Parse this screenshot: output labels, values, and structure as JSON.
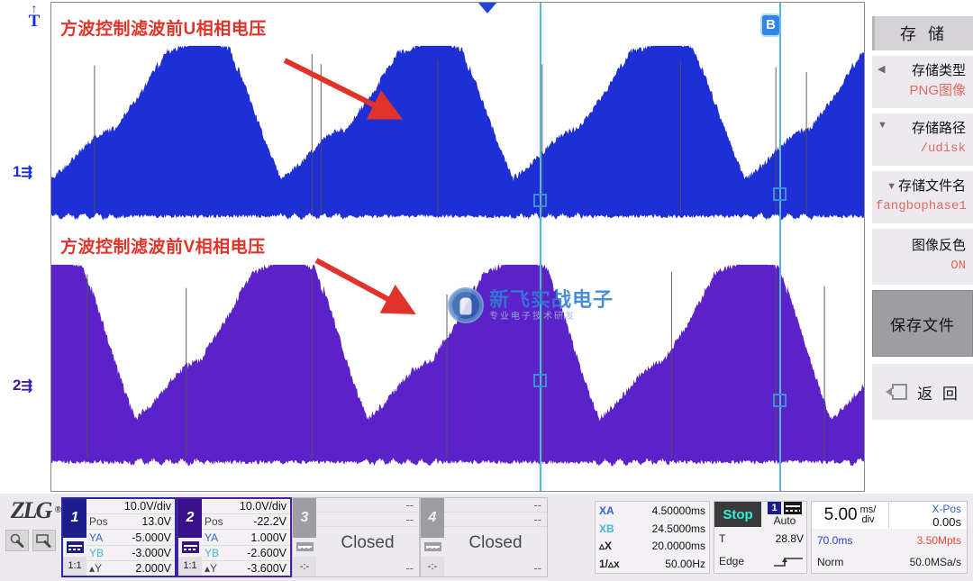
{
  "annotations": {
    "ch1_note": "方波控制滤波前U相相电压",
    "ch2_note": "方波控制滤波前V相相电压"
  },
  "markers": {
    "trigger_level_label": "T",
    "ch1_label": "1",
    "ch2_label": "2",
    "cursor_b_label": "B"
  },
  "watermark": {
    "main": "新飞实战电子",
    "sub": "专业电子技术研发"
  },
  "menu": {
    "title": "存 储",
    "items": [
      {
        "label": "存储类型",
        "value": "PNG图像",
        "caret": "left"
      },
      {
        "label": "存储路径",
        "value": "/udisk",
        "caret": "down"
      },
      {
        "label": "存储文件名",
        "value": "fangbophase1",
        "caret": "down"
      },
      {
        "label": "图像反色",
        "value": "ON",
        "caret": "none"
      }
    ],
    "save_button": "保存文件",
    "back_button": "返 回",
    "back_icon": "back-arrow-icon"
  },
  "status": {
    "brand": "ZLG",
    "brand_mark": "®",
    "icons": [
      "measure-icon",
      "screen-icon"
    ],
    "channels": [
      {
        "num": "1",
        "closed": false,
        "scale": "10.0V/div",
        "pos_label": "Pos",
        "pos": "13.0V",
        "ya_label": "YA",
        "ya": "-5.000V",
        "yb_label": "YB",
        "yb": "-3.000V",
        "dy_label": "▴Y",
        "dy": "2.000V",
        "ratio": "1:1",
        "coupling": "dc-ac-icon"
      },
      {
        "num": "2",
        "closed": false,
        "scale": "10.0V/div",
        "pos_label": "Pos",
        "pos": "-22.2V",
        "ya_label": "YA",
        "ya": "1.000V",
        "yb_label": "YB",
        "yb": "-2.600V",
        "dy_label": "▴Y",
        "dy": "-3.600V",
        "ratio": "1:1",
        "coupling": "dc-ac-icon"
      },
      {
        "num": "3",
        "closed": true,
        "closed_text": "Closed",
        "dash": "--",
        "ratio": "-:-"
      },
      {
        "num": "4",
        "closed": true,
        "closed_text": "Closed",
        "dash": "--",
        "ratio": "-:-"
      }
    ],
    "cursors": {
      "xa_label": "XA",
      "xa": "4.50000ms",
      "xb_label": "XB",
      "xb": "24.5000ms",
      "dx_label": "▵X",
      "dx": "20.0000ms",
      "fx_label": "1/▵x",
      "fx": "50.00Hz"
    },
    "trigger": {
      "run_state": "Stop",
      "source": "1",
      "sweep": "Auto",
      "t_label": "T",
      "level": "28.8V",
      "type": "Edge",
      "slope_icon": "rising-edge-icon"
    },
    "timebase": {
      "scale_value": "5.00",
      "scale_unit_top": "ms/",
      "scale_unit_bot": "div",
      "xpos_label": "X-Pos",
      "xpos": "0.00s",
      "memory_depth_time": "70.0ms",
      "memory_points": "3.50Mpts",
      "acq_mode": "Norm",
      "sample_rate": "50.0MSa/s"
    }
  },
  "colors": {
    "ch1": "#1f2fd6",
    "ch2": "#5a22c8",
    "annotation": "#e0342a",
    "cursor": "#56b6e0",
    "accent_value": "#e06a62"
  }
}
